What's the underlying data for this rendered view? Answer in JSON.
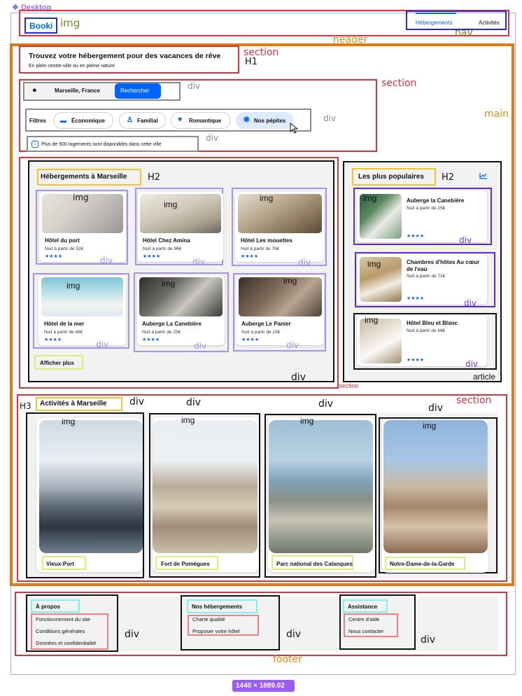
{
  "canvas": {
    "frame_label": "Desktop",
    "size_label": "1440 × 1889.02"
  },
  "overlay_labels": {
    "img": "img",
    "nav": "nav",
    "header": "header",
    "main": "main",
    "section": "section",
    "h1": "H1",
    "h2": "H2",
    "h3": "H3",
    "div": "div",
    "article": "article",
    "footer": "footer"
  },
  "header": {
    "logo": "Booki",
    "nav": [
      {
        "label": "Hébergements",
        "active": true
      },
      {
        "label": "Activités",
        "active": false
      }
    ]
  },
  "hero": {
    "title": "Trouvez votre hébergement pour des vacances de rêve",
    "subtitle": "En plein centre-ville ou en pleine nature"
  },
  "search": {
    "value": "Marseille, France",
    "button": "Rechercher",
    "icon": "location-pin-icon"
  },
  "filters": {
    "label": "Filtres",
    "items": [
      {
        "label": "Économique",
        "icon": "money-icon"
      },
      {
        "label": "Familial",
        "icon": "child-icon"
      },
      {
        "label": "Romantique",
        "icon": "heart-icon"
      },
      {
        "label": "Nos pépites",
        "icon": "fire-icon"
      }
    ],
    "info": "Plus de 500 logements sont disponibles dans cette ville"
  },
  "hebergements": {
    "title": "Hébergements à Marseille",
    "cards": [
      {
        "name": "Hôtel du port",
        "price": "Nuit à partir de 52€",
        "rating": 4
      },
      {
        "name": "Hôtel Chez Amina",
        "price": "Nuit à partir de 96€",
        "rating": 4
      },
      {
        "name": "Hôtel Les mouettes",
        "price": "Nuit à partir de 76€",
        "rating": 4
      },
      {
        "name": "Hôtel de la mer",
        "price": "Nuit à partir de 46€",
        "rating": 4
      },
      {
        "name": "Auberge La Canebière",
        "price": "Nuit à partir de 25€",
        "rating": 4
      },
      {
        "name": "Auberge Le Panier",
        "price": "Nuit à partir de 23€",
        "rating": 4
      }
    ],
    "more": "Afficher plus"
  },
  "populaires": {
    "title": "Les plus populaires",
    "icon": "trend-chart-icon",
    "cards": [
      {
        "name": "Auberge la Canebière",
        "price": "Nuit à partir de 25€",
        "rating": 4
      },
      {
        "name": "Chambres d'hôtes Au cœur de l'eau",
        "price": "Nuit à partir de 71€",
        "rating": 4
      },
      {
        "name": "Hôtel Bleu et Blanc",
        "price": "Nuit à partir de 68€",
        "rating": 4
      }
    ]
  },
  "activites": {
    "title": "Activités à Marseille",
    "items": [
      {
        "label": "Vieux-Port"
      },
      {
        "label": "Fort de Pomègues"
      },
      {
        "label": "Parc national des Calanques"
      },
      {
        "label": "Notre-Dame-de-la-Garde"
      }
    ]
  },
  "footer": {
    "columns": [
      {
        "title": "À propos",
        "links": [
          "Fonctionnement du site",
          "Conditions générales",
          "Données et confidentialité"
        ]
      },
      {
        "title": "Nos hébergements",
        "links": [
          "Charte qualité",
          "Proposer votre hôtel"
        ]
      },
      {
        "title": "Assistance",
        "links": [
          "Centre d'aide",
          "Nous contacter"
        ]
      }
    ]
  },
  "colors": {
    "primary": "#0065FC",
    "annotation_red": "#E0303A",
    "frame_purple": "#A791EF",
    "bg_gray": "#F2F2F2"
  }
}
